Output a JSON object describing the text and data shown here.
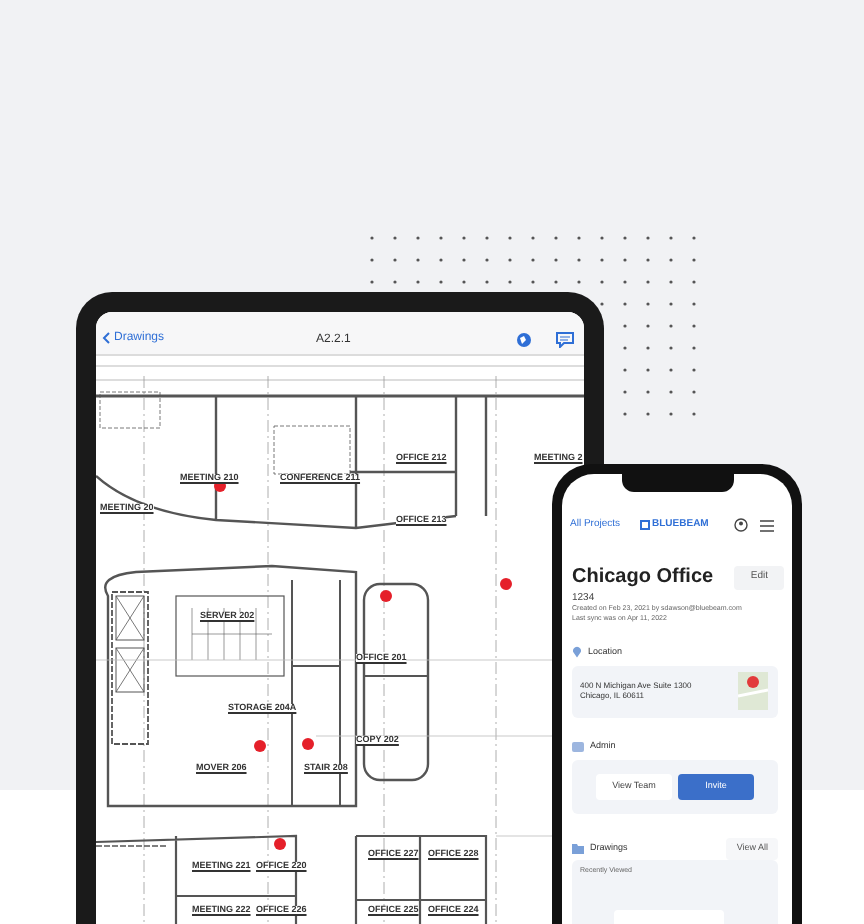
{
  "tablet": {
    "nav": {
      "back_label": "Drawings",
      "title": "A2.2.1"
    },
    "rooms": [
      {
        "label": "MEETING 20"
      },
      {
        "label": "MEETING 210"
      },
      {
        "label": "CONFERENCE 211"
      },
      {
        "label": "OFFICE 212"
      },
      {
        "label": "OFFICE 213"
      },
      {
        "label": "MEETING 2"
      },
      {
        "label": "SERVER 202"
      },
      {
        "label": "STORAGE 204A"
      },
      {
        "label": "OFFICE 201"
      },
      {
        "label": "COPY 202"
      },
      {
        "label": "MOVER 206"
      },
      {
        "label": "STAIR 208"
      },
      {
        "label": "MEETING 221"
      },
      {
        "label": "OFFICE 220"
      },
      {
        "label": "OFFICE 227"
      },
      {
        "label": "OFFICE 228"
      },
      {
        "label": "MEETING 222"
      },
      {
        "label": "OFFICE 226"
      },
      {
        "label": "OFFICE 225"
      },
      {
        "label": "OFFICE 224"
      }
    ]
  },
  "phone": {
    "nav": {
      "back_link": "All Projects",
      "logo": "BLUEBEAM"
    },
    "project": {
      "title": "Chicago Office",
      "edit_button": "Edit",
      "number": "1234",
      "created": "Created on Feb 23, 2021 by sdawson@bluebeam.com",
      "last_sync": "Last sync was on Apr 11, 2022"
    },
    "location": {
      "heading": "Location",
      "address_lines": [
        "400 N Michigan Ave Suite 1300",
        "Chicago, IL 60611"
      ]
    },
    "admin": {
      "heading": "Admin",
      "buttons": [
        {
          "label": "View Team",
          "kind": "secondary"
        },
        {
          "label": "Invite",
          "kind": "primary"
        }
      ]
    },
    "drawings": {
      "heading": "Drawings",
      "view_all": "View All",
      "recently_viewed": "Recently Viewed"
    }
  }
}
